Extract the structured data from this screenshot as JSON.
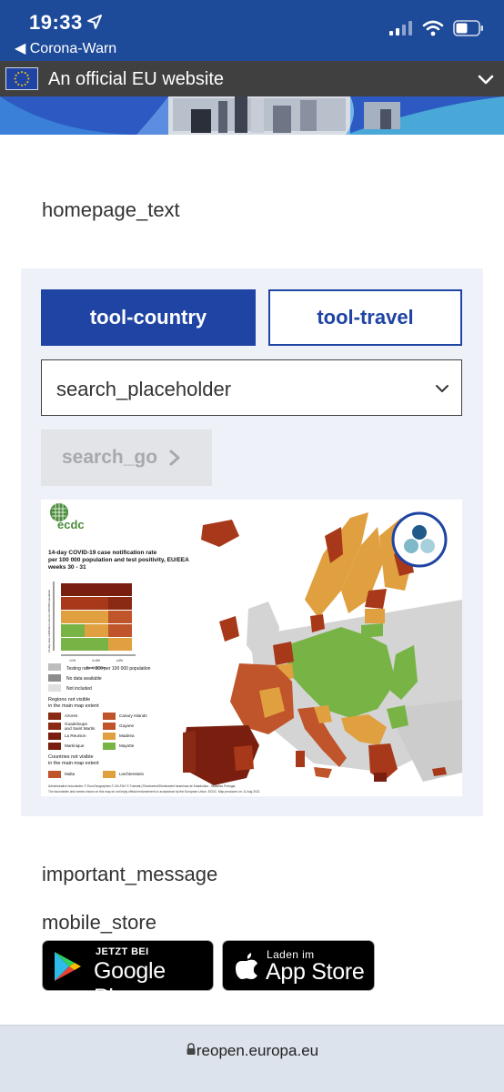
{
  "status_bar": {
    "time": "19:33",
    "back_label": "◀ Corona-Warn"
  },
  "eu_bar": {
    "text": "An official EU website"
  },
  "homepage_text": "homepage_text",
  "tools": {
    "country_label": "tool-country",
    "travel_label": "tool-travel"
  },
  "search": {
    "placeholder": "search_placeholder",
    "go_label": "search_go"
  },
  "map": {
    "logo_text": "ecdc",
    "title_lines": [
      "14-day COVID-19 case notification rate",
      "per 100 000 population and test positivity, EU/EEA",
      "weeks 30 - 31"
    ],
    "y_axis_label": "14-day case notification rate per 100 000 population",
    "x_axis_label": "Positivity rate",
    "x_ticks": [
      "<1%",
      "1<4%",
      "≥4%"
    ],
    "legend_grey": [
      "Testing rate < 300 per 100 000 population",
      "No data available",
      "Not included"
    ],
    "regions_heading": "Regions not visible\nin the main map extent",
    "regions": [
      {
        "name": "Azores",
        "color": "#8b2a14"
      },
      {
        "name": "Canary Islands",
        "color": "#c0542a"
      },
      {
        "name": "Guadeloupe\nand Saint Martin",
        "color": "#8b2a14"
      },
      {
        "name": "Guyane",
        "color": "#c0542a"
      },
      {
        "name": "La Reunion",
        "color": "#7a1f10"
      },
      {
        "name": "Madeira",
        "color": "#e0a040"
      },
      {
        "name": "Martinique",
        "color": "#7a1f10"
      },
      {
        "name": "Mayotte",
        "color": "#77b345"
      }
    ],
    "countries_heading": "Countries not visible\nin the main map extent",
    "countries": [
      {
        "name": "Malta",
        "color": "#c0542a"
      },
      {
        "name": "Liechtenstein",
        "color": "#e0a040"
      }
    ],
    "footnote_1": "Administrative boundaries: © EuroGeographics © UN-FAO © Turkstat (©Kartverket/Direktoratet foraminas de Estadística - Statistics Portugal.",
    "footnote_2": "The boundaries and names shown on this map do not imply official endorsement or acceptance by the European Union. ECDC. Map produced on: 11 Aug 2021",
    "colors": {
      "dark_red": "#7a1f10",
      "red": "#a8381a",
      "orange_red": "#c0542a",
      "orange": "#e0a040",
      "green": "#77b345",
      "grey": "#d4d4d4",
      "sea": "#ffffff"
    }
  },
  "important_message": "important_message",
  "mobile_store": "mobile_store",
  "badges": {
    "google_small": "JETZT BEI",
    "google_big": "Google Play",
    "apple_small": "Laden im",
    "apple_big": "App Store"
  },
  "url_bar": {
    "url": "reopen.europa.eu"
  }
}
